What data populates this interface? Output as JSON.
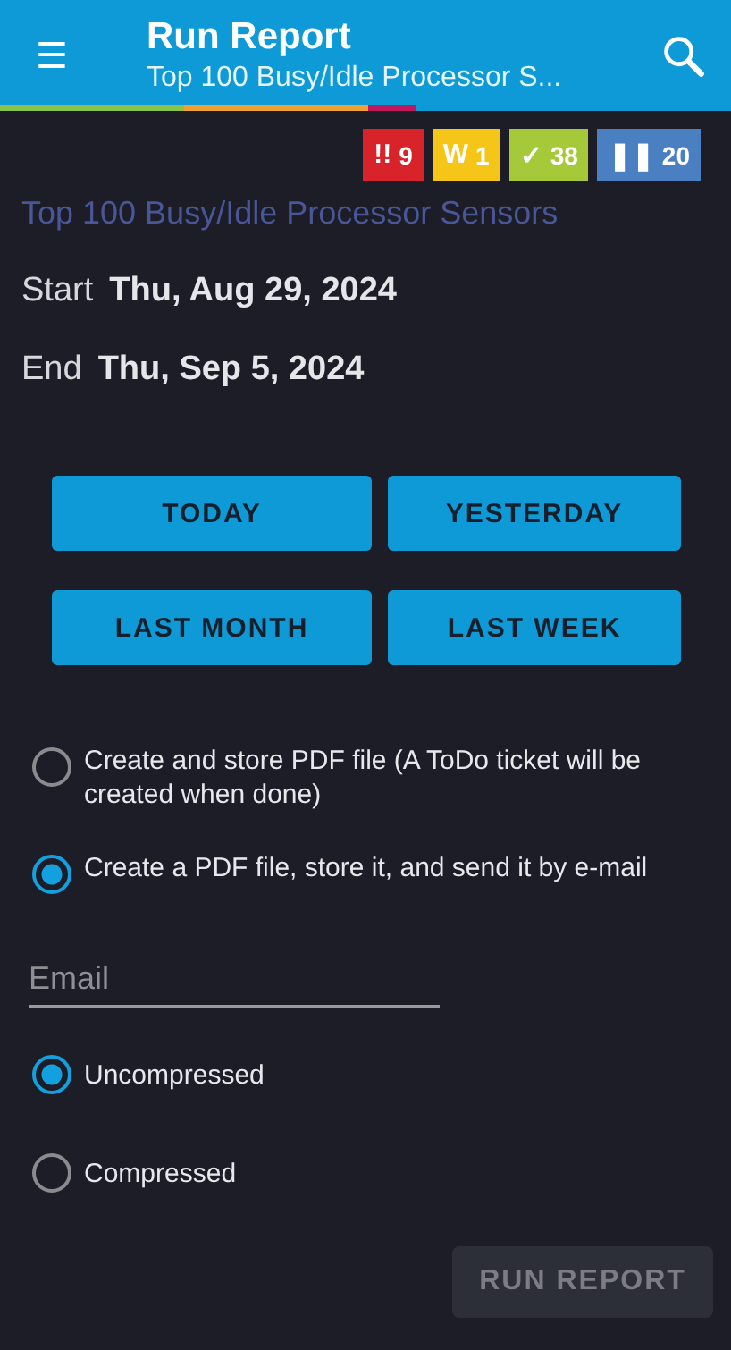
{
  "header": {
    "menu_icon": "☰",
    "title": "Run Report",
    "subtitle": "Top 100 Busy/Idle Processor S..."
  },
  "status_badges": [
    {
      "icon": "!!",
      "count": "9",
      "color": "#d8232a"
    },
    {
      "icon": "W",
      "count": "1",
      "color": "#f5c518"
    },
    {
      "icon": "✓",
      "count": "38",
      "color": "#a6c939"
    },
    {
      "icon": "❚❚",
      "count": "20",
      "color": "#4a7fc1"
    }
  ],
  "report_name": "Top 100 Busy/Idle Processor Sensors",
  "start": {
    "label": "Start",
    "value": "Thu, Aug 29, 2024"
  },
  "end": {
    "label": "End",
    "value": "Thu, Sep 5, 2024"
  },
  "range_buttons": [
    "TODAY",
    "YESTERDAY",
    "LAST MONTH",
    "LAST WEEK"
  ],
  "output_options": [
    {
      "label": "Create and store PDF file (A ToDo ticket will be created when done)",
      "selected": false
    },
    {
      "label": "Create a PDF file, store it, and send it by e-mail",
      "selected": true
    }
  ],
  "email": {
    "placeholder": "Email"
  },
  "compression_options": [
    {
      "label": "Uncompressed",
      "selected": true
    },
    {
      "label": "Compressed",
      "selected": false
    }
  ],
  "run_button": {
    "label": "RUN REPORT",
    "disabled": true
  }
}
